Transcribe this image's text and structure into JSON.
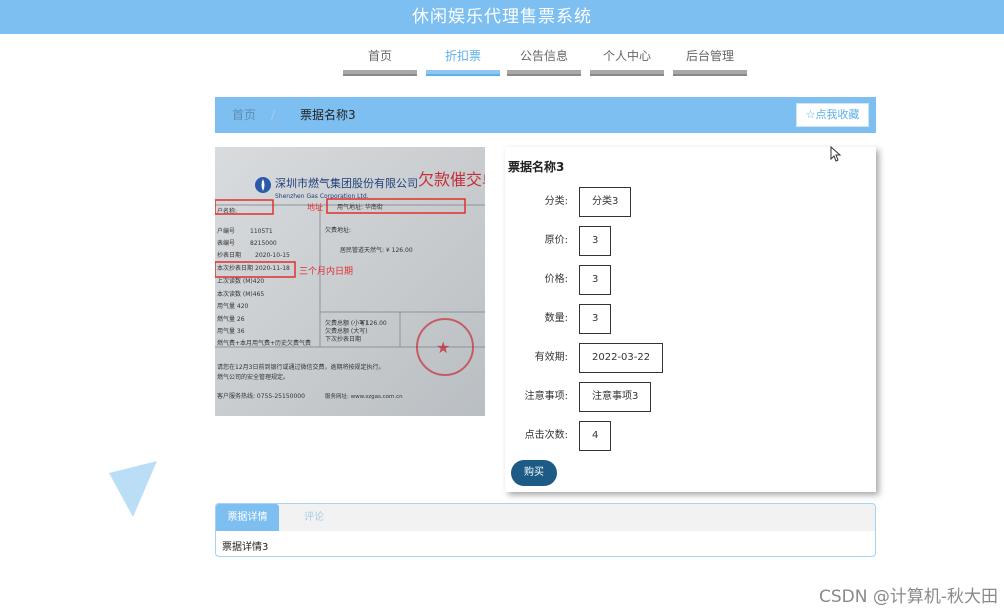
{
  "app": {
    "title": "休闲娱乐代理售票系统"
  },
  "nav": {
    "items": [
      {
        "label": "首页",
        "active": false
      },
      {
        "label": "折扣票",
        "active": true
      },
      {
        "label": "公告信息",
        "active": false
      },
      {
        "label": "个人中心",
        "active": false
      },
      {
        "label": "后台管理",
        "active": false
      }
    ]
  },
  "breadcrumb": {
    "home": "首页",
    "separator": "/",
    "current": "票据名称3"
  },
  "favorite": {
    "label": "点我收藏",
    "icon": "star-outline-icon"
  },
  "photo": {
    "company_cn": "深圳市燃气集团股份有限公司",
    "company_en": "Shenzhen Gas Corporation Ltd.",
    "stamp_title": "欠款催交单",
    "annotation_address": "地址",
    "annotation_date": "三个月内日期",
    "amount": "¥ 126.00",
    "date_a": "2020-10-15",
    "date_b": "2020-11-18",
    "phone": "0755-25150000",
    "field_labels": [
      "户名称",
      "户编号",
      "表编号",
      "抄表日期",
      "本次抄表日期",
      "上次读数",
      "本次读数",
      "用气量",
      "燃气量",
      "用气量"
    ],
    "footer_text": "请您在12月3日前到银行或通过微信交费，逾期将按规定执行。"
  },
  "detail": {
    "title": "票据名称3",
    "fields": [
      {
        "label": "分类:",
        "value": "分类3"
      },
      {
        "label": "原价:",
        "value": "3"
      },
      {
        "label": "价格:",
        "value": "3"
      },
      {
        "label": "数量:",
        "value": "3"
      },
      {
        "label": "有效期:",
        "value": "2022-03-22"
      },
      {
        "label": "注意事项:",
        "value": "注意事项3"
      },
      {
        "label": "点击次数:",
        "value": "4"
      }
    ],
    "buy_label": "购买"
  },
  "tabs": {
    "items": [
      {
        "label": "票据详情",
        "active": true
      },
      {
        "label": "评论",
        "active": false
      }
    ],
    "content": "票据详情3"
  },
  "watermark": "CSDN @计算机-秋大田",
  "colors": {
    "primary": "#7dbff0",
    "buy": "#1d5a86",
    "nav_bar": "#a8a8a8"
  }
}
